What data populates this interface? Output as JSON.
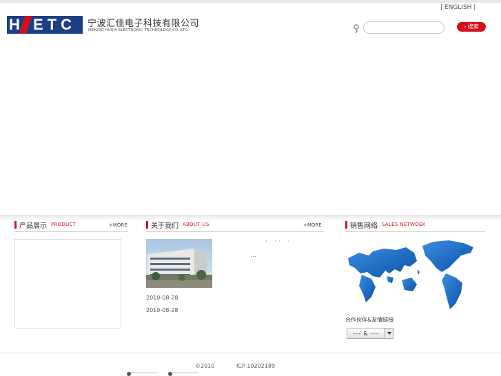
{
  "header": {
    "lang_link": "| ENGLISH |",
    "company_name_cn": "宁波汇佳电子科技有限公司",
    "company_name_en": "NINGBO HUIJIA ELECTRONIC TECHNOLOGY CO.,LTD.",
    "logo": {
      "text": "HETC",
      "colors": {
        "blue": "#1c3f84",
        "red": "#d3111b"
      }
    },
    "search": {
      "value": "",
      "placeholder": "",
      "button_label": "› 搜索",
      "icon": "key-icon"
    }
  },
  "product": {
    "title_cn": "产品展示",
    "title_en": "PRODUCT",
    "more_label": "+MORE"
  },
  "about": {
    "title_cn": "关于我们",
    "title_en": "ABOUT US",
    "more_label": "+MORE",
    "dots": "· ·· ·",
    "ellipsis": "...",
    "dates": [
      "2010-08-28",
      "2010-08-28"
    ]
  },
  "sales": {
    "title_cn": "销售网络",
    "title_en": "SALES NETWOEK",
    "partner_label": "合作伙伴&友情链接",
    "partner_select_value": "---  &  ---"
  },
  "footer": {
    "copyright": "©2010",
    "icp": "ICP 10202189"
  },
  "accent_color": "#d3111b"
}
